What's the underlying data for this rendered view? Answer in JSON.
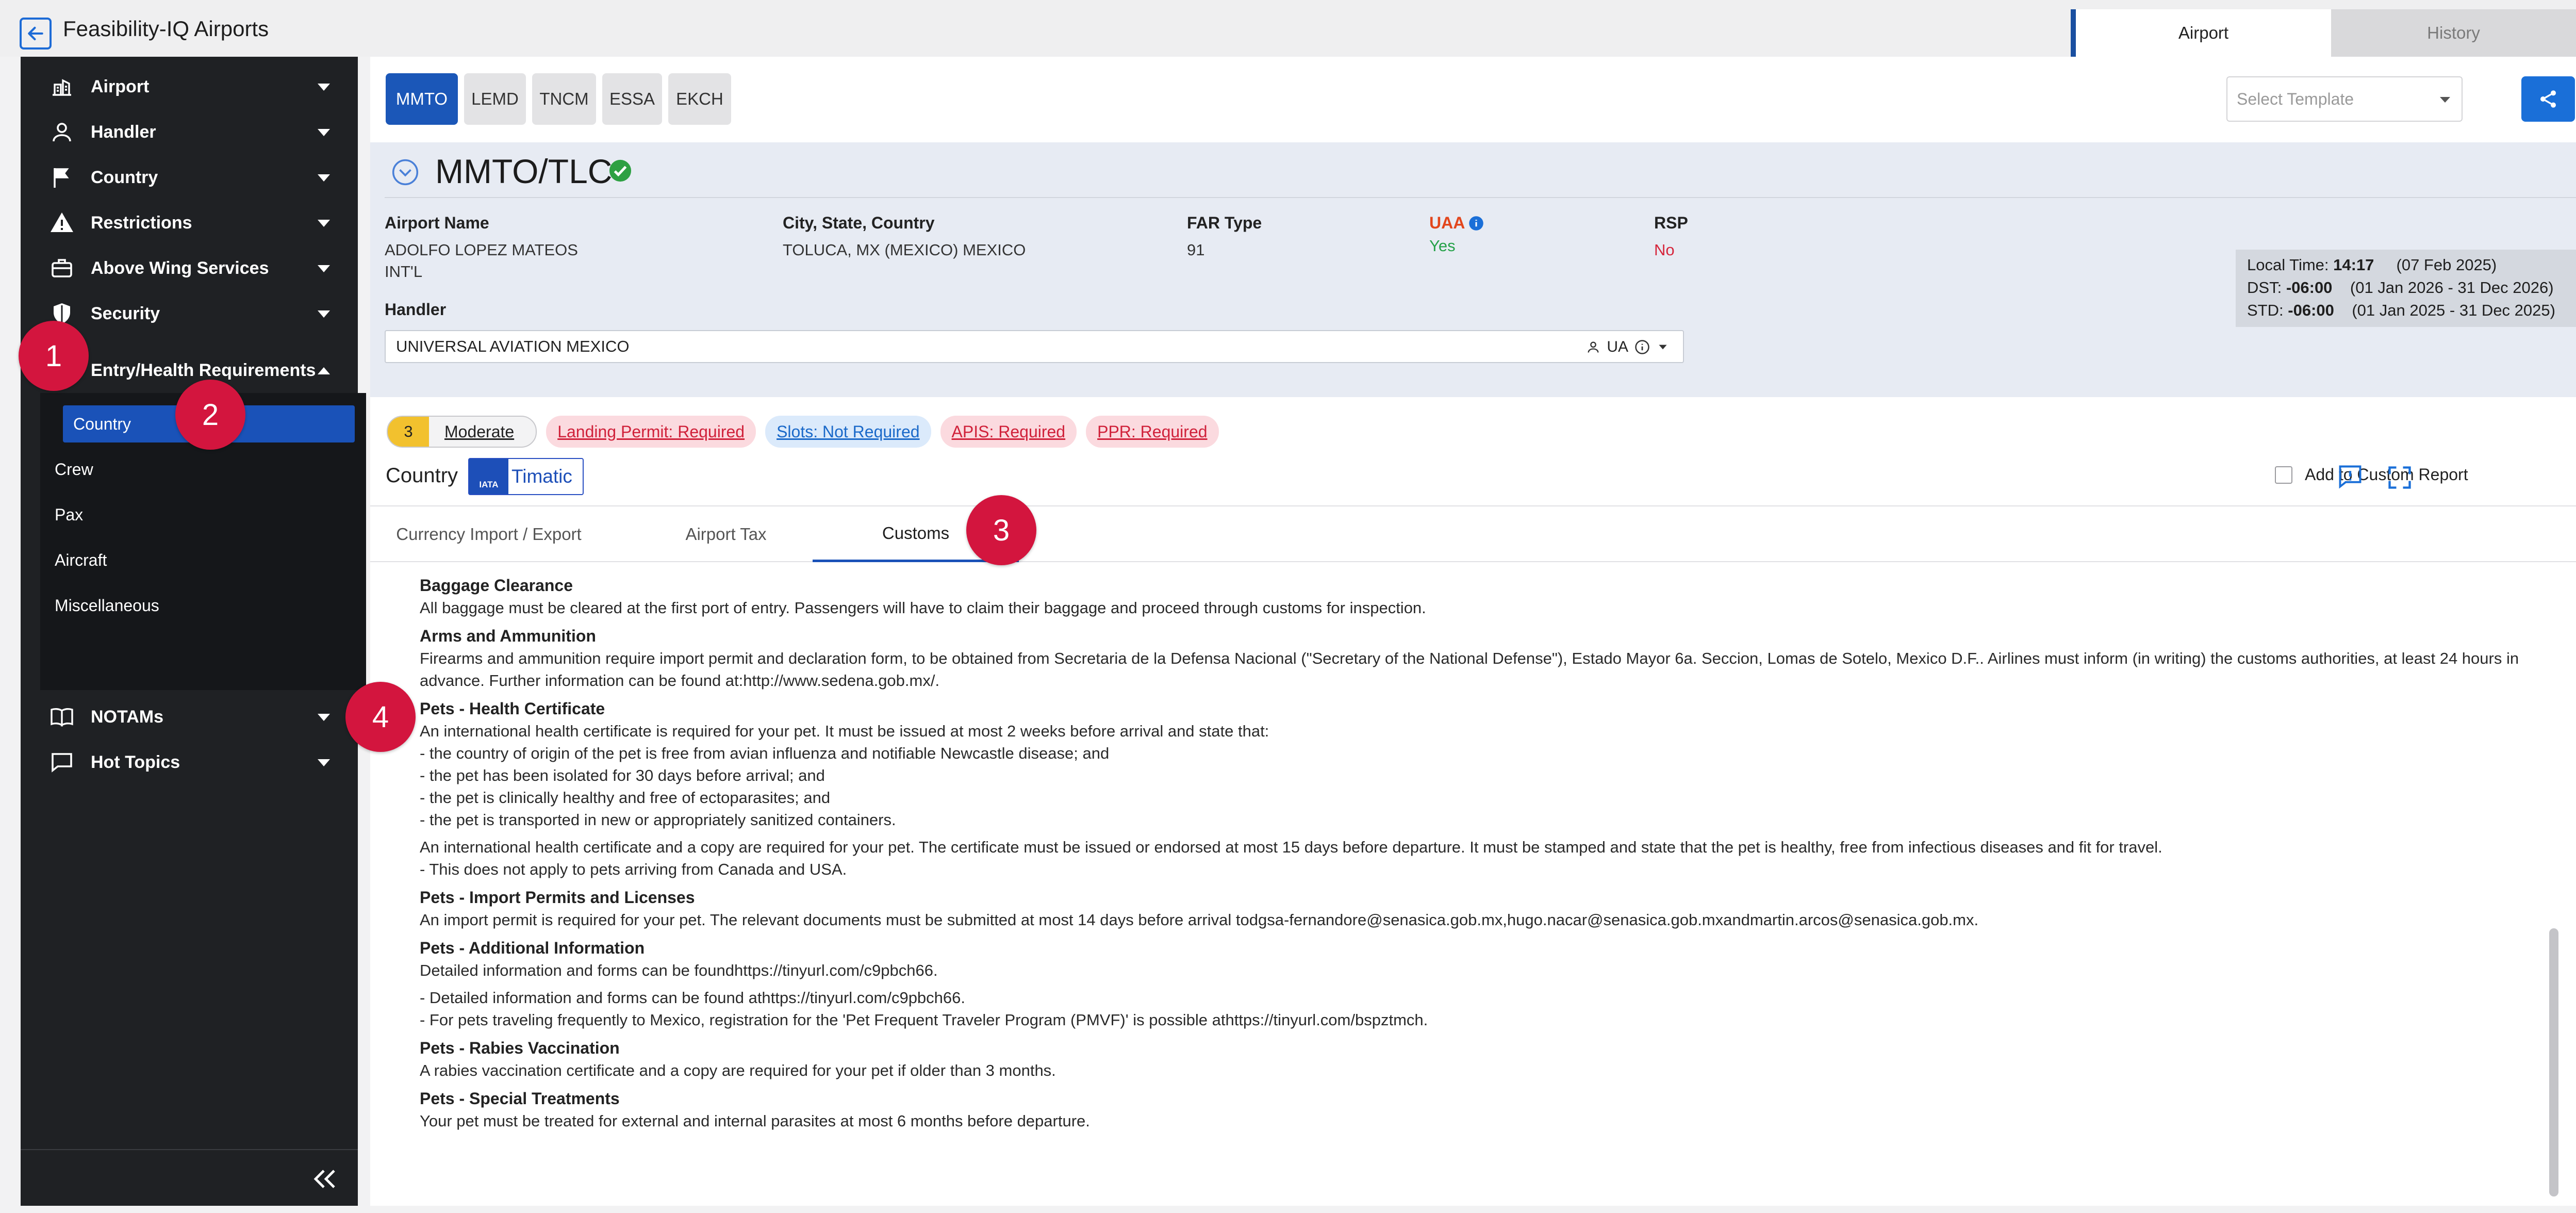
{
  "app": {
    "title": "Feasibility-IQ Airports"
  },
  "top_tabs": [
    {
      "label": "Airport",
      "active": true
    },
    {
      "label": "History",
      "active": false
    }
  ],
  "sidebar": {
    "items": [
      {
        "label": "Airport",
        "icon": "airport-icon"
      },
      {
        "label": "Handler",
        "icon": "person-icon"
      },
      {
        "label": "Country",
        "icon": "flag-icon"
      },
      {
        "label": "Restrictions",
        "icon": "warning-icon"
      },
      {
        "label": "Above Wing Services",
        "icon": "briefcase-icon"
      },
      {
        "label": "Security",
        "icon": "shield-icon"
      },
      {
        "label": "Entry/Health Requirements",
        "icon": "health-icon",
        "expanded": true
      },
      {
        "label": "NOTAMs",
        "icon": "book-icon"
      },
      {
        "label": "Hot Topics",
        "icon": "chat-icon"
      }
    ],
    "subitems": [
      {
        "label": "Country",
        "active": true
      },
      {
        "label": "Crew"
      },
      {
        "label": "Pax"
      },
      {
        "label": "Aircraft"
      },
      {
        "label": "Miscellaneous"
      }
    ]
  },
  "airport_tabs": [
    "MMTO",
    "LEMD",
    "TNCM",
    "ESSA",
    "EKCH"
  ],
  "template_select": {
    "placeholder": "Select Template"
  },
  "airport": {
    "id": "MMTO/TLC",
    "name_label": "Airport Name",
    "name_line1": "ADOLFO LOPEZ MATEOS",
    "name_line2": "INT'L",
    "city_label": "City, State, Country",
    "city_value": "TOLUCA, MX (MEXICO) MEXICO",
    "far_label": "FAR Type",
    "far_value": "91",
    "uaa_label": "UAA",
    "uaa_value": "Yes",
    "rsp_label": "RSP",
    "rsp_value": "No",
    "handler_label": "Handler",
    "handler_value": "UNIVERSAL AVIATION MEXICO",
    "handler_tag": "UA"
  },
  "time": {
    "local_label": "Local Time:",
    "local_value": "14:17",
    "local_date": "(07 Feb 2025)",
    "dst_label": "DST:",
    "dst_value": "-06:00",
    "dst_range": "(01 Jan 2026 - 31 Dec 2026)",
    "std_label": "STD:",
    "std_value": "-06:00",
    "std_range": "(01 Jan 2025 - 31 Dec 2025)"
  },
  "risk": {
    "level": "3",
    "label": "Moderate",
    "color": "#f2c12e"
  },
  "badges": [
    {
      "label": "Landing Permit: Required",
      "tone": "red"
    },
    {
      "label": "Slots: Not Required",
      "tone": "blue"
    },
    {
      "label": "APIS: Required",
      "tone": "red"
    },
    {
      "label": "PPR: Required",
      "tone": "red"
    }
  ],
  "section": {
    "title": "Country",
    "logo_iata": "IATA",
    "logo_word": "Timatic",
    "custom_report_label": "Add to Custom Report"
  },
  "subtabs": [
    {
      "label": "Currency Import / Export"
    },
    {
      "label": "Airport Tax"
    },
    {
      "label": "Customs",
      "active": true
    }
  ],
  "content": [
    {
      "title": "Baggage Clearance",
      "paras": [
        "All baggage must be cleared at the first port of entry. Passengers will have to claim their baggage and proceed through customs for inspection."
      ]
    },
    {
      "title": "Arms and Ammunition",
      "paras": [
        "Firearms and ammunition require import permit and declaration form, to be obtained from Secretaria de la Defensa Nacional (\"Secretary of the National Defense\"), Estado Mayor 6a. Seccion, Lomas de Sotelo, Mexico D.F.. Airlines must inform (in writing) the customs authorities, at least 24 hours in advance. Further information can be found at:http://www.sedena.gob.mx/."
      ]
    },
    {
      "title": "Pets - Health Certificate",
      "paras": [
        "An international health certificate is required for your pet. It must be issued at most 2 weeks before arrival and state that:\n- the country of origin of the pet is free from avian influenza and notifiable Newcastle disease; and\n- the pet has been isolated for 30 days before arrival; and\n- the pet is clinically healthy and free of ectoparasites; and\n- the pet is transported in new or appropriately sanitized containers.",
        "An international health certificate and a copy are required for your pet. The certificate must be issued or endorsed at most 15 days before departure. It must be stamped and state that the pet is healthy, free from infectious diseases and fit for travel.\n- This does not apply to pets arriving from Canada and USA."
      ]
    },
    {
      "title": "Pets - Import Permits and Licenses",
      "paras": [
        "An import permit is required for your pet. The relevant documents must be submitted at most 14 days before arrival todgsa-fernandore@senasica.gob.mx,hugo.nacar@senasica.gob.mxandmartin.arcos@senasica.gob.mx."
      ]
    },
    {
      "title": "Pets - Additional Information",
      "paras": [
        "Detailed information and forms can be foundhttps://tinyurl.com/c9pbch66.",
        "- Detailed information and forms can be found athttps://tinyurl.com/c9pbch66.\n- For pets traveling frequently to Mexico, registration for the 'Pet Frequent Traveler Program (PMVF)' is possible athttps://tinyurl.com/bspztmch."
      ]
    },
    {
      "title": "Pets - Rabies Vaccination",
      "paras": [
        "A rabies vaccination certificate and a copy are required for your pet if older than 3 months."
      ]
    },
    {
      "title": "Pets - Special Treatments",
      "paras": [
        "Your pet must be treated for external and internal parasites at most 6 months before departure."
      ]
    }
  ],
  "markers": [
    "1",
    "2",
    "3",
    "4"
  ],
  "colors": {
    "accent": "#1a52b8",
    "marker": "#d3153e",
    "sidebar": "#1f2124"
  }
}
